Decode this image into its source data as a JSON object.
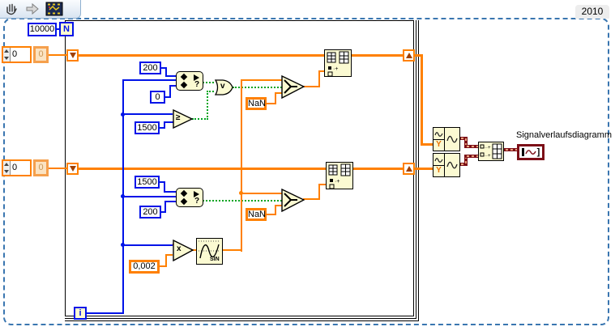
{
  "version_label": "2010",
  "toolbar": {
    "tools": [
      {
        "name": "hand-tool"
      },
      {
        "name": "navigate-arrow"
      },
      {
        "name": "vi-snippet"
      }
    ]
  },
  "for_loop": {
    "count_value": "10000",
    "count_terminal": "N",
    "iteration_terminal": "i"
  },
  "shift_registers": {
    "top": {
      "control_value": "0",
      "init_value": "0"
    },
    "bottom": {
      "control_value": "0",
      "init_value": "0"
    }
  },
  "top_branch": {
    "range_upper": "200",
    "range_lower": "0",
    "in_range_glyph": "?",
    "gte_threshold": "1500",
    "gte_glyph": "≥",
    "or_glyph": "v",
    "nan_constant": "NaN"
  },
  "bottom_branch": {
    "range_upper": "1500",
    "range_lower": "200",
    "in_range_glyph": "?",
    "nan_constant": "NaN",
    "multiply_glyph": "x",
    "time_step": "0,002",
    "sine_label": "SIN"
  },
  "build_waveform": {
    "top_input": "Y",
    "bottom_input": "Y"
  },
  "chart": {
    "label": "Signalverlaufsdiagramm"
  },
  "colors": {
    "numeric_wire": "#ff8000",
    "integer_wire": "#0013e8",
    "boolean_wire": "#00a420",
    "waveform_wire": "#7c0e17",
    "node_fill": "#fbfad2",
    "snippet_border": "#3a76b0"
  }
}
